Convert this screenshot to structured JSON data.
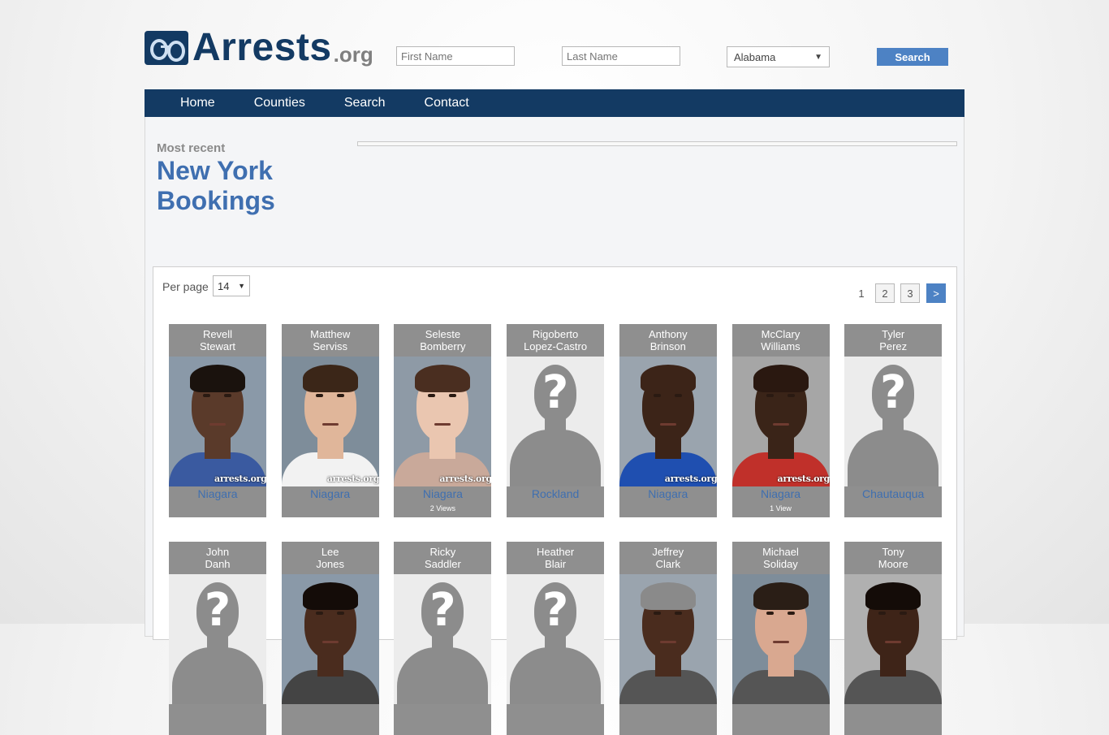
{
  "header": {
    "logo_main": "Arrests",
    "logo_tld": ".org",
    "first_name_placeholder": "First Name",
    "last_name_placeholder": "Last Name",
    "state_selected": "Alabama",
    "search_label": "Search"
  },
  "nav": {
    "items": [
      {
        "label": "Home"
      },
      {
        "label": "Counties"
      },
      {
        "label": "Search"
      },
      {
        "label": "Contact"
      }
    ]
  },
  "main": {
    "subtitle": "Most recent",
    "title_line1": "New York",
    "title_line2": "Bookings"
  },
  "listing": {
    "per_page_label": "Per page",
    "per_page_value": "14",
    "pagination": [
      "1",
      "2",
      "3",
      ">"
    ],
    "watermark": "arrests.org",
    "cards": [
      {
        "first": "Revell",
        "last": "Stewart",
        "county": "Niagara",
        "views": "",
        "photo": "real",
        "skin": "#5a3a2a",
        "hair": "#1a120d",
        "shirt": "#3a5aa0",
        "bg": "#8a99a8"
      },
      {
        "first": "Matthew",
        "last": "Serviss",
        "county": "Niagara",
        "views": "",
        "photo": "real",
        "skin": "#e0b69a",
        "hair": "#3b2618",
        "shirt": "#f2f2f2",
        "bg": "#7e8d9a"
      },
      {
        "first": "Seleste",
        "last": "Bomberry",
        "county": "Niagara",
        "views": "2 Views",
        "photo": "real",
        "skin": "#eac6b0",
        "hair": "#4a2e20",
        "shirt": "#c9a99a",
        "bg": "#8e9aa6"
      },
      {
        "first": "Rigoberto",
        "last": "Lopez-Castro",
        "county": "Rockland",
        "views": "",
        "photo": "unknown"
      },
      {
        "first": "Anthony",
        "last": "Brinson",
        "county": "Niagara",
        "views": "",
        "photo": "real",
        "skin": "#3c2418",
        "hair": "#3c2418",
        "shirt": "#1f4fb0",
        "bg": "#9aa4ae"
      },
      {
        "first": "McClary",
        "last": "Williams",
        "county": "Niagara",
        "views": "1 View",
        "photo": "real",
        "skin": "#3a2418",
        "hair": "#2a1810",
        "shirt": "#c0302a",
        "bg": "#a6a6a6"
      },
      {
        "first": "Tyler",
        "last": "Perez",
        "county": "Chautauqua",
        "views": "",
        "photo": "unknown"
      },
      {
        "first": "John",
        "last": "Danh",
        "county": "",
        "views": "",
        "photo": "unknown"
      },
      {
        "first": "Lee",
        "last": "Jones",
        "county": "",
        "views": "",
        "photo": "real",
        "skin": "#4a2c1e",
        "hair": "#140c08",
        "shirt": "#444444",
        "bg": "#8a99a8"
      },
      {
        "first": "Ricky",
        "last": "Saddler",
        "county": "",
        "views": "",
        "photo": "unknown"
      },
      {
        "first": "Heather",
        "last": "Blair",
        "county": "",
        "views": "",
        "photo": "unknown"
      },
      {
        "first": "Jeffrey",
        "last": "Clark",
        "county": "",
        "views": "",
        "photo": "real",
        "skin": "#4a2c1e",
        "hair": "#8a8a8a",
        "shirt": "#555555",
        "bg": "#9aa4ae"
      },
      {
        "first": "Michael",
        "last": "Soliday",
        "county": "",
        "views": "",
        "photo": "real",
        "skin": "#d9a890",
        "hair": "#2a1e16",
        "shirt": "#555555",
        "bg": "#7e8d9a"
      },
      {
        "first": "Tony",
        "last": "Moore",
        "county": "",
        "views": "",
        "photo": "real",
        "skin": "#3e2418",
        "hair": "#140c08",
        "shirt": "#555555",
        "bg": "#b0b0b0"
      }
    ]
  }
}
